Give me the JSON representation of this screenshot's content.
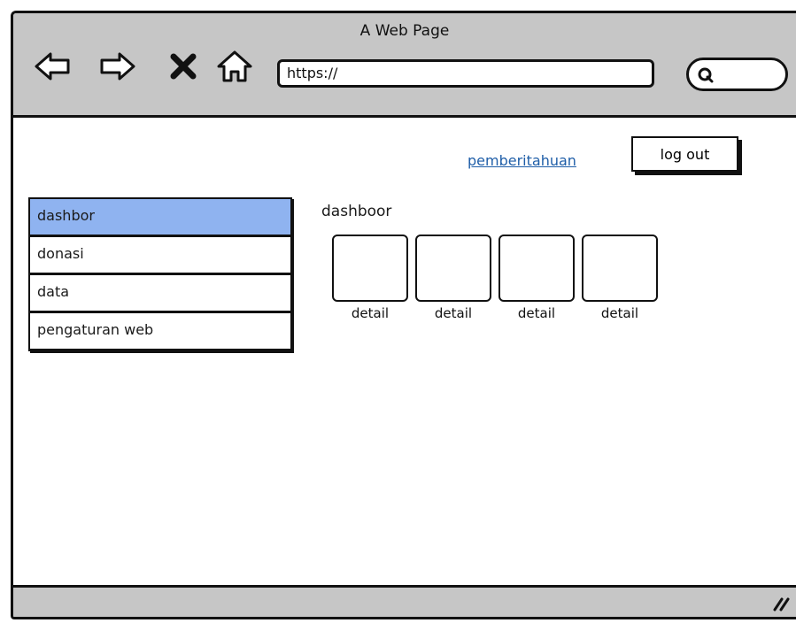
{
  "window": {
    "title": "A Web Page"
  },
  "toolbar": {
    "icons": [
      "back-arrow-icon",
      "forward-arrow-icon",
      "close-x-icon",
      "home-icon"
    ],
    "url": "https://",
    "search_icon": "search-icon"
  },
  "header": {
    "notification_link": "pemberitahuan",
    "logout_label": "log out"
  },
  "sidebar": {
    "items": [
      {
        "label": "dashbor",
        "active": true
      },
      {
        "label": "donasi",
        "active": false
      },
      {
        "label": "data",
        "active": false
      },
      {
        "label": "pengaturan web",
        "active": false
      }
    ]
  },
  "main": {
    "title": "dashboor",
    "cards": [
      {
        "label": "detail"
      },
      {
        "label": "detail"
      },
      {
        "label": "detail"
      },
      {
        "label": "detail"
      }
    ]
  },
  "colors": {
    "chrome": "#c6c6c6",
    "active_item": "#8fb3f0",
    "link": "#1f5ea8"
  }
}
